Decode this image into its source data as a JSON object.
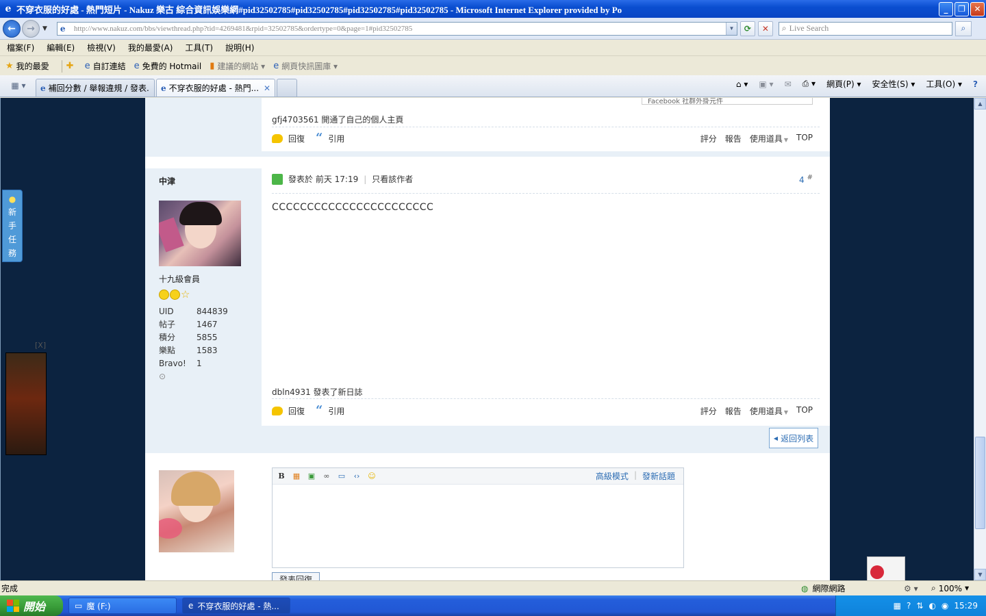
{
  "window": {
    "title": "不穿衣服的好處 - 熱門短片 - Nakuz 樂古 綜合資訊娛樂網#pid32502785#pid32502785#pid32502785#pid32502785 - Microsoft Internet Explorer provided by Po",
    "minimize": "_",
    "maximize": "❐",
    "close": "✕"
  },
  "address": {
    "url": "http://www.nakuz.com/bbs/viewthread.php?tid=4269481&rpid=32502785&ordertype=0&page=1#pid32502785",
    "search_placeholder": "Live Search"
  },
  "menu": [
    "檔案(F)",
    "編輯(E)",
    "檢視(V)",
    "我的最愛(A)",
    "工具(T)",
    "說明(H)"
  ],
  "favorites": {
    "favorites_label": "我的最愛",
    "items": [
      "自訂連結",
      "免費的 Hotmail",
      "建議的網站 ▾",
      "網頁快訊圖庫 ▾"
    ]
  },
  "tabs": [
    {
      "label": "補回分數 / 舉報違規 / 發表..."
    },
    {
      "label": "不穿衣服的好處 - 熱門..."
    }
  ],
  "cmdbar": {
    "page": "網頁(P) ▾",
    "safety": "安全性(S) ▾",
    "tools": "工具(O) ▾",
    "help": "?"
  },
  "post_prev": {
    "activity": "gfj4703561 開通了自己的個人主頁",
    "facebook_stub": "Facebook 社群外掛元件"
  },
  "post_actions": {
    "reply": "回復",
    "quote": "引用",
    "rate": "評分",
    "report": "報告",
    "tools": "使用道具",
    "top": "TOP"
  },
  "post": {
    "author": "中津",
    "meta_posted": "發表於 前天 17:19",
    "meta_only_author": "只看該作者",
    "floor": "4",
    "floor_suffix": "#",
    "body": "CCCCCCCCCCCCCCCCCCCCCCC",
    "activity": "dbln4931 發表了新日誌",
    "rank": "十九級會員",
    "stats": [
      {
        "k": "UID",
        "v": "844839"
      },
      {
        "k": "帖子",
        "v": "1467"
      },
      {
        "k": "積分",
        "v": "5855"
      },
      {
        "k": "樂點",
        "v": "1583"
      },
      {
        "k": "Bravo!",
        "v": "1"
      }
    ]
  },
  "back_to_list": "返回列表",
  "editor": {
    "advanced_mode": "高級模式",
    "new_topic": "發新話題",
    "submit": "發表回復"
  },
  "sidebar_tab": [
    "新",
    "手",
    "任",
    "務"
  ],
  "ad_close": "[X]",
  "status": {
    "left": "完成",
    "zone": "網際網路",
    "zoom": "100%"
  },
  "taskbar": {
    "start": "開始",
    "tasks": [
      "魔 (F:)",
      "不穿衣服的好處 - 熱..."
    ],
    "clock": "15:29"
  }
}
